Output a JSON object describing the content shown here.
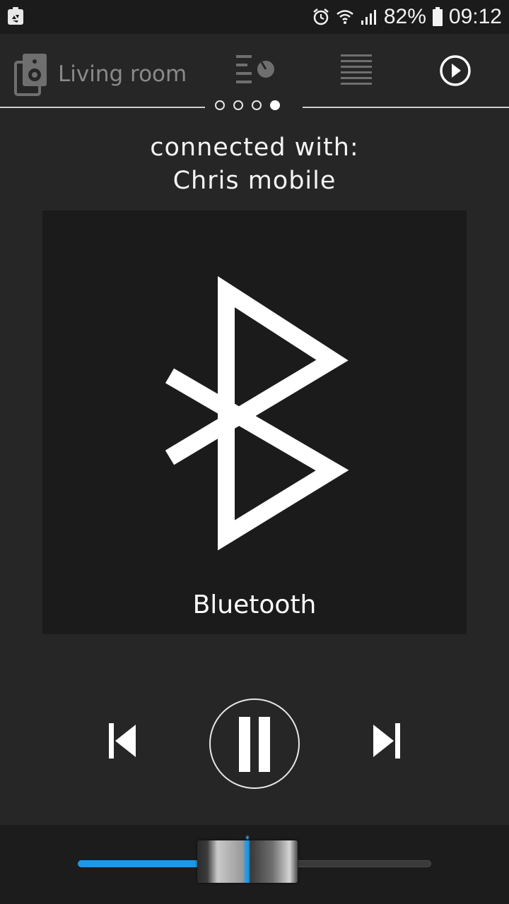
{
  "status_bar": {
    "battery_percent": "82%",
    "time": "09:12",
    "icons": [
      "recycle-notification-icon",
      "alarm-icon",
      "wifi-icon",
      "signal-icon",
      "battery-icon"
    ]
  },
  "toolbar": {
    "room_label": "Living room",
    "icons": [
      "speaker-icon",
      "equalizer-icon",
      "list-icon",
      "play-circle-icon"
    ]
  },
  "pager": {
    "pages": 4,
    "active_index": 3
  },
  "connection": {
    "line1": "connected with:",
    "line2": "Chris mobile"
  },
  "source": {
    "label": "Bluetooth",
    "icon": "bluetooth-icon"
  },
  "controls": {
    "prev_icon": "skip-previous-icon",
    "pause_icon": "pause-icon",
    "next_icon": "skip-next-icon"
  },
  "volume": {
    "level_percent": 48,
    "accent_color": "#1e98e6"
  }
}
